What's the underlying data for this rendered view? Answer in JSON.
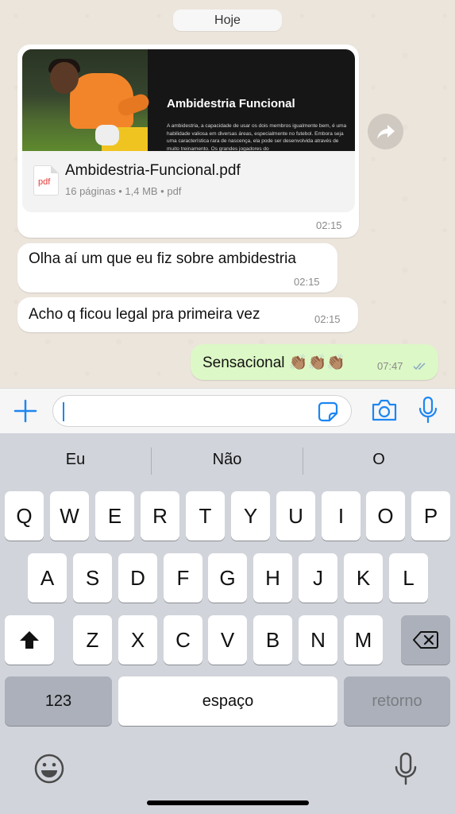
{
  "chat": {
    "date_label": "Hoje",
    "document_message": {
      "preview_title": "Ambidestria Funcional",
      "preview_body": "A ambidestria, a capacidade de usar os dois membros igualmente bem, é uma habilidade valiosa em diversas áreas, especialmente no futebol. Embora seja uma característica rara de nascença, ela pode ser desenvolvida através de muito treinamento. Os grandes jogadores do",
      "file_icon_label": "pdf",
      "file_name": "Ambidestria-Funcional.pdf",
      "file_meta": "16 páginas • 1,4 MB • pdf",
      "time": "02:15"
    },
    "messages": [
      {
        "text": "Olha aí um que eu fiz sobre ambidestria",
        "time": "02:15",
        "direction": "incoming"
      },
      {
        "text": "Acho q ficou legal pra primeira vez",
        "time": "02:15",
        "direction": "incoming"
      },
      {
        "text": "Sensacional 👏🏽👏🏽👏🏽",
        "time": "07:47",
        "direction": "outgoing",
        "status": "read"
      }
    ]
  },
  "input_bar": {
    "icons": [
      "plus-icon",
      "sticker-icon",
      "camera-icon",
      "mic-icon"
    ],
    "accent_color": "#1d86f2"
  },
  "keyboard": {
    "suggestions": [
      "Eu",
      "Não",
      "O"
    ],
    "row1": [
      "Q",
      "W",
      "E",
      "R",
      "T",
      "Y",
      "U",
      "I",
      "O",
      "P"
    ],
    "row2": [
      "A",
      "S",
      "D",
      "F",
      "G",
      "H",
      "J",
      "K",
      "L"
    ],
    "row3": [
      "Z",
      "X",
      "C",
      "V",
      "B",
      "N",
      "M"
    ],
    "numbers_label": "123",
    "space_label": "espaço",
    "return_label": "retorno"
  }
}
